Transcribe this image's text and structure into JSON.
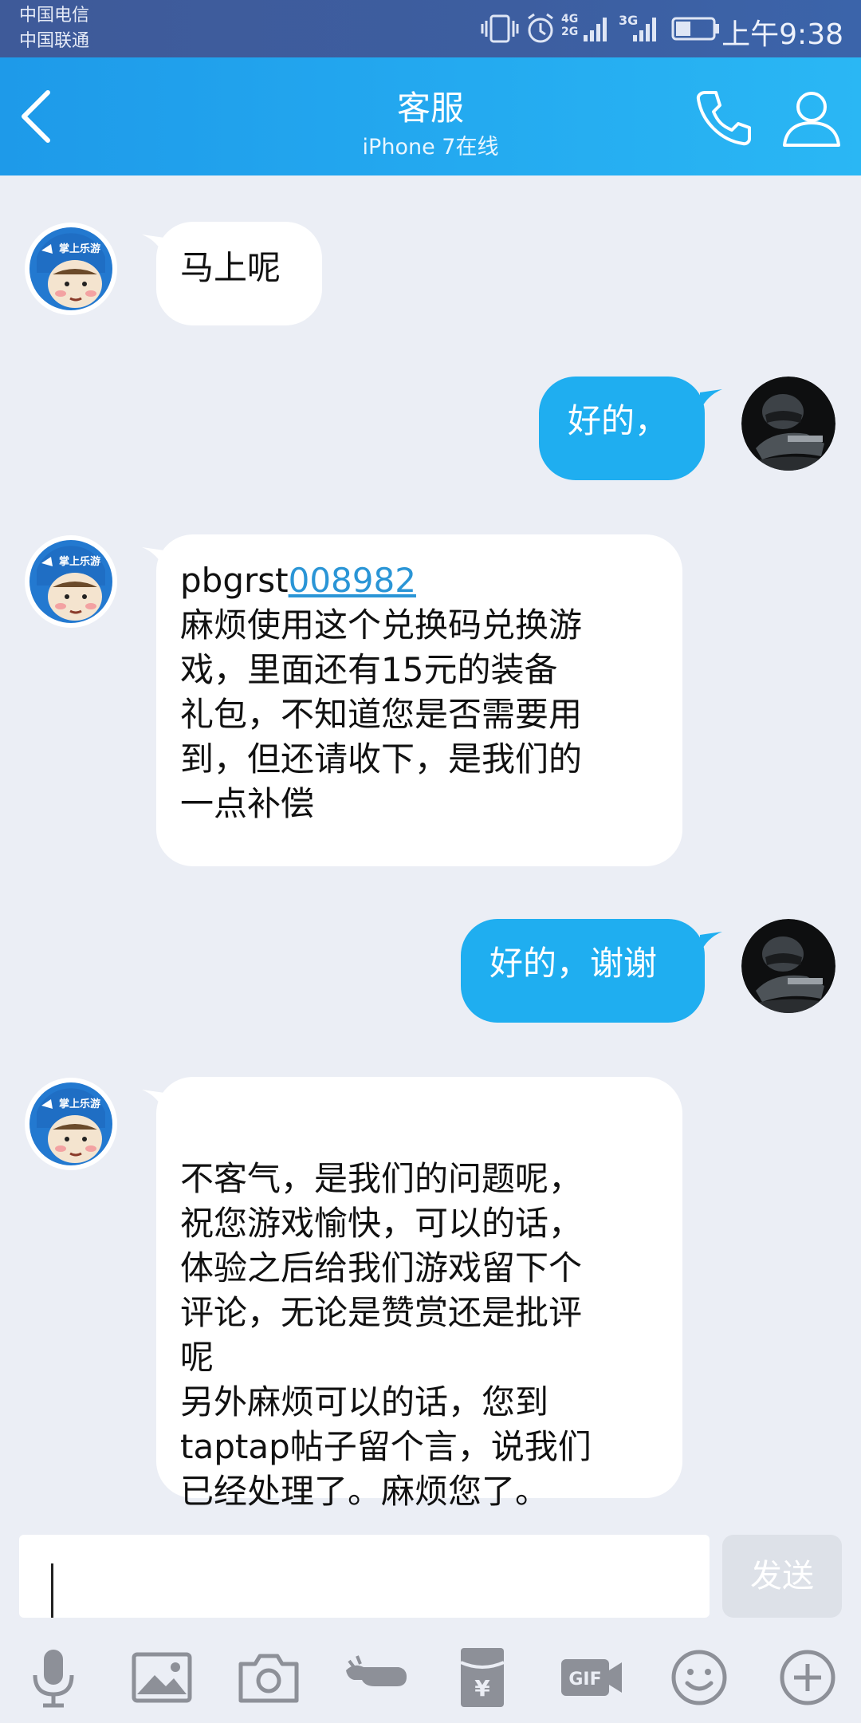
{
  "status_bar": {
    "carrier_1": "中国电信",
    "carrier_2": "中国联通",
    "network_1": "4G 2G",
    "network_2": "3G",
    "time": "上午9:38",
    "icons": [
      "vibrate-icon",
      "alarm-icon",
      "signal-icon",
      "signal-icon",
      "battery-icon"
    ]
  },
  "header": {
    "title": "客服",
    "subtitle": "iPhone 7在线",
    "back_icon": "chevron-left-icon",
    "call_icon": "phone-icon",
    "profile_icon": "person-icon"
  },
  "messages": [
    {
      "side": "in",
      "text": "马上呢"
    },
    {
      "side": "out",
      "text": "好的，"
    },
    {
      "side": "in",
      "text_prefix": "pbgrst",
      "link": "008982",
      "text": "麻烦使用这个兑换码兑换游\n戏，里面还有15元的装备\n礼包，不知道您是否需要用\n到，但还请收下，是我们的\n一点补偿"
    },
    {
      "side": "out",
      "text": "好的，谢谢"
    },
    {
      "side": "in",
      "text": "不客气，是我们的问题呢，\n祝您游戏愉快，可以的话，\n体验之后给我们游戏留下个\n评论，无论是赞赏还是批评\n呢\n另外麻烦可以的话，您到\ntaptap帖子留个言，说我们\n已经处理了。麻烦您了。"
    }
  ],
  "agent_avatar_badge": "掌上乐游",
  "input": {
    "value": "",
    "send_label": "发送"
  },
  "toolbar": [
    "microphone-icon",
    "image-icon",
    "camera-icon",
    "poke-icon",
    "red-packet-icon",
    "gif-icon",
    "emoji-icon",
    "plus-icon"
  ],
  "colors": {
    "header": "#24aaf0",
    "outgoing_bubble": "#1faef0",
    "link": "#2a95d6",
    "background": "#ebeef5"
  }
}
